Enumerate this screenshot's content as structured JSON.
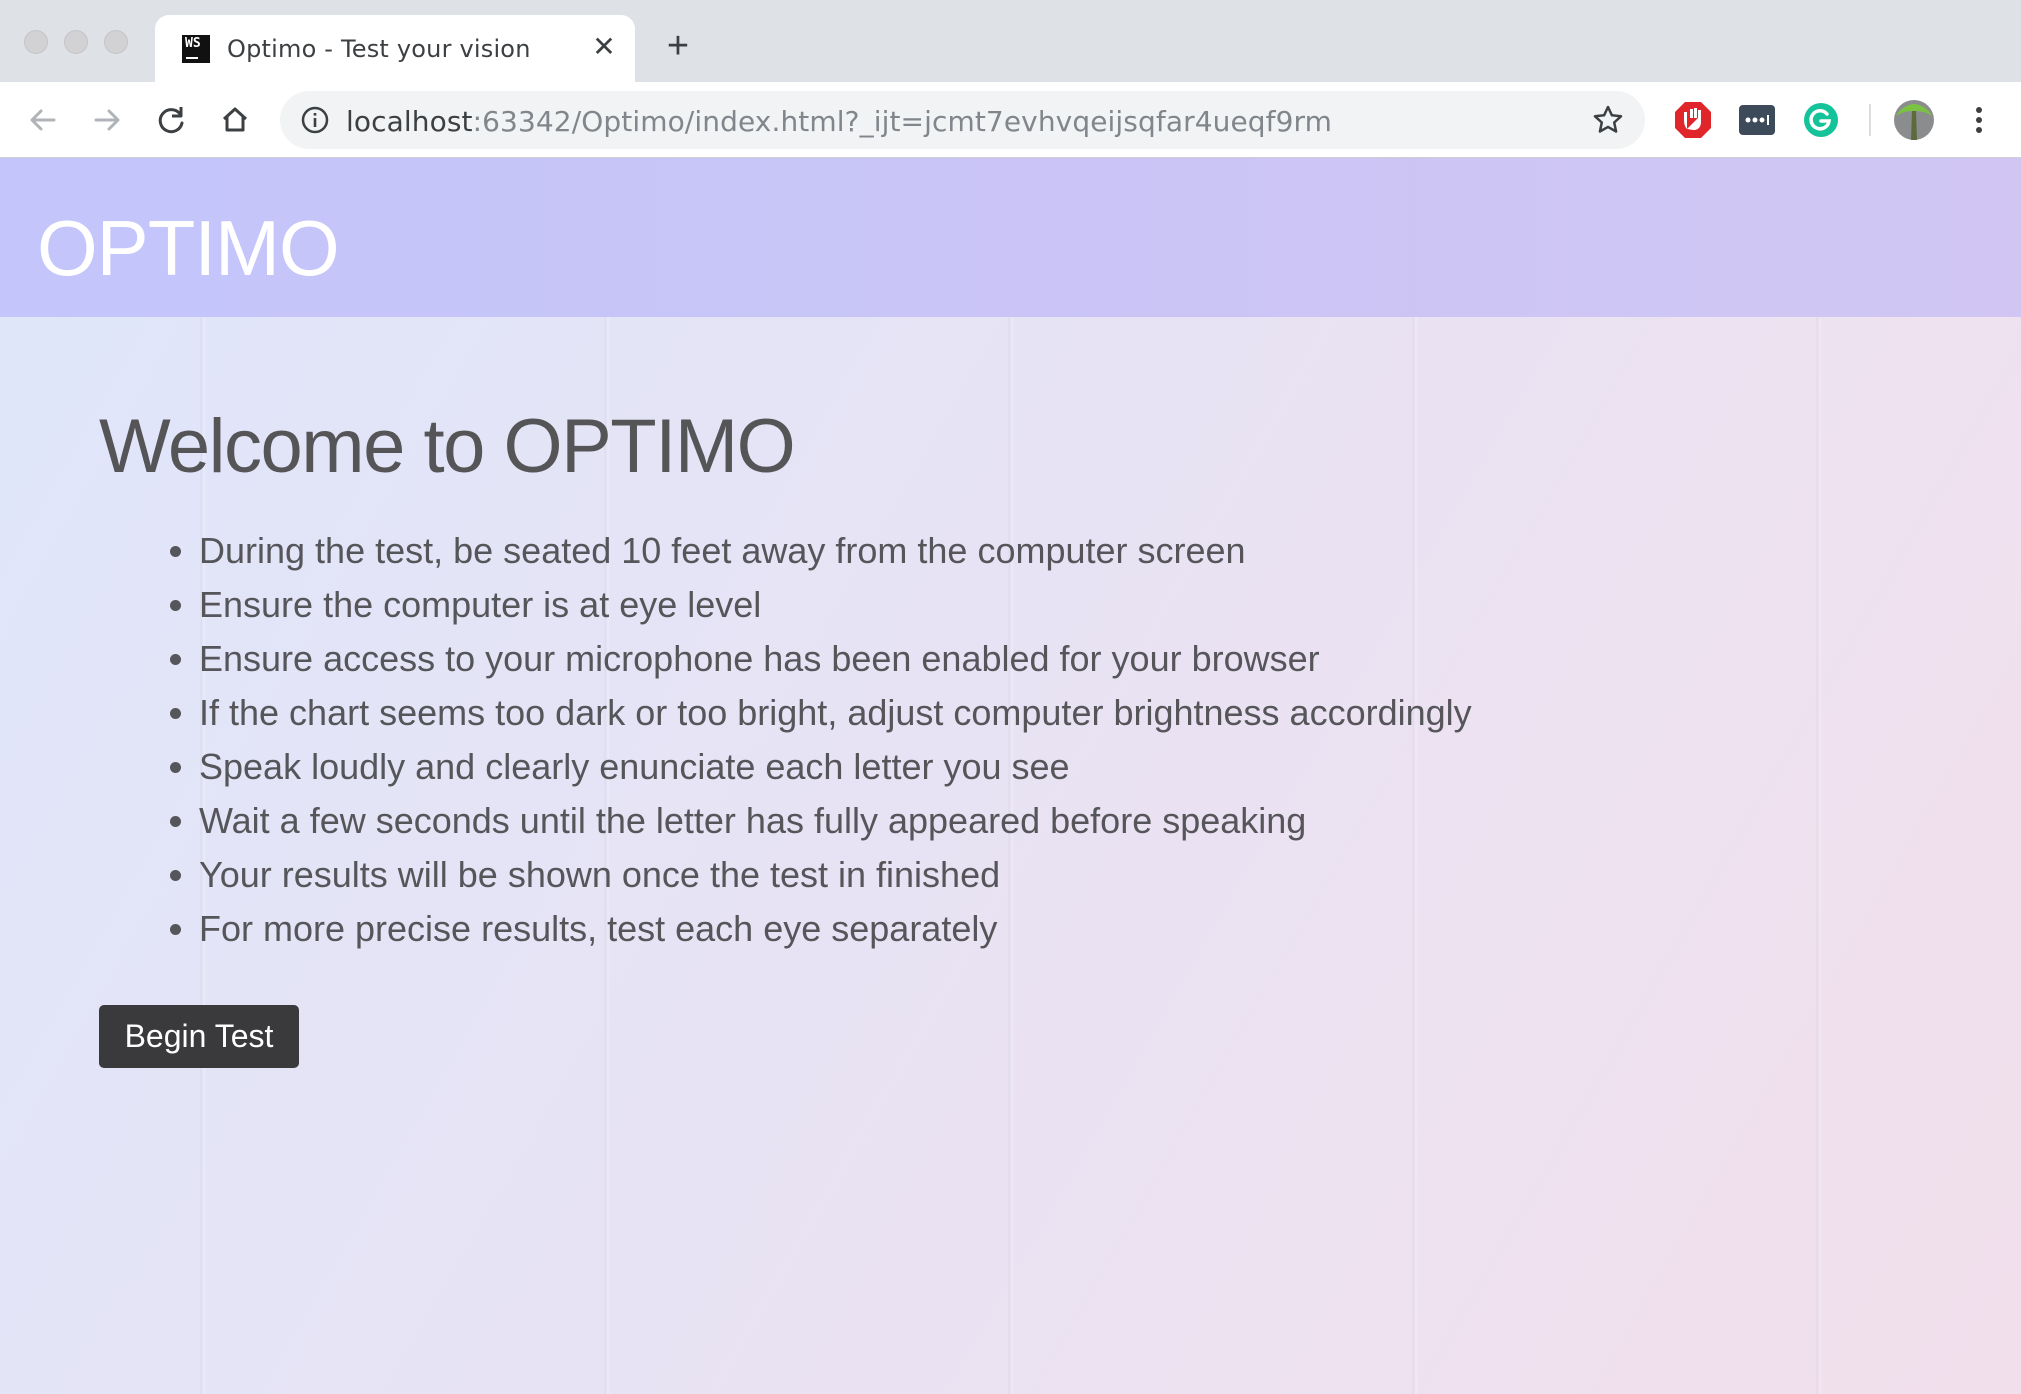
{
  "browser": {
    "tab": {
      "title": "Optimo - Test your vision",
      "favicon_text": "WS",
      "close_glyph": "✕"
    },
    "new_tab_glyph": "+",
    "url": {
      "host": "localhost",
      "rest": ":63342/Optimo/index.html?_ijt=jcmt7evhvqeijsqfar4ueqf9rm"
    },
    "icons": [
      "back-icon",
      "forward-icon",
      "reload-icon",
      "home-icon",
      "site-info-icon",
      "star-icon",
      "adblock-icon",
      "password-manager-icon",
      "grammarly-icon",
      "profile-avatar-icon",
      "menu-icon"
    ]
  },
  "page": {
    "brand": "OPTIMO",
    "heading": "Welcome to OPTIMO",
    "rules": [
      "During the test, be seated 10 feet away from the computer screen",
      "Ensure the computer is at eye level",
      "Ensure access to your microphone has been enabled for your browser",
      "If the chart seems too dark or too bright, adjust computer brightness accordingly",
      "Speak loudly and clearly enunciate each letter you see",
      "Wait a few seconds until the letter has fully appeared before speaking",
      "Your results will be shown once the test in finished",
      "For more precise results, test each eye separately"
    ],
    "button_label": "Begin Test"
  },
  "colors": {
    "navbar": "#c7c5f8",
    "button": "#3a3a3c",
    "text": "#55555a",
    "adblock_red": "#e0262a",
    "grammarly_green": "#15c39a"
  }
}
